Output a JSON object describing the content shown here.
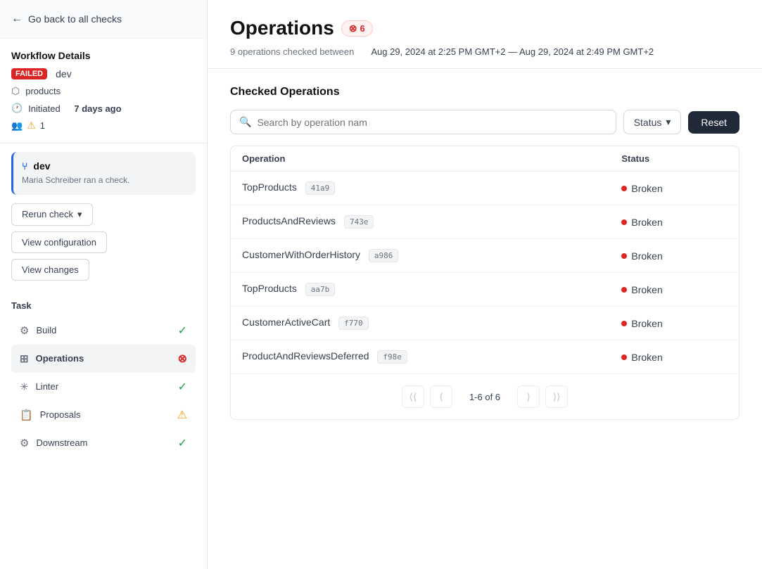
{
  "back": {
    "label": "Go back to all checks"
  },
  "sidebar": {
    "workflow_details_title": "Workflow Details",
    "failed_badge": "FAILED",
    "env": "dev",
    "products_label": "products",
    "initiated_label": "Initiated",
    "initiated_ago": "7 days ago",
    "alert_count": "1",
    "dev_card": {
      "name": "dev",
      "sub": "Maria Schreiber ran a check."
    },
    "buttons": {
      "rerun": "Rerun check",
      "view_config": "View configuration",
      "view_changes": "View changes"
    },
    "task_title": "Task",
    "tasks": [
      {
        "id": "build",
        "label": "Build",
        "status": "success"
      },
      {
        "id": "operations",
        "label": "Operations",
        "status": "fail",
        "active": true
      },
      {
        "id": "linter",
        "label": "Linter",
        "status": "success"
      },
      {
        "id": "proposals",
        "label": "Proposals",
        "status": "warn"
      },
      {
        "id": "downstream",
        "label": "Downstream",
        "status": "success"
      }
    ]
  },
  "main": {
    "title": "Operations",
    "error_badge": "6",
    "meta_ops": "9 operations checked between",
    "meta_range": "Aug 29, 2024 at 2:25 PM GMT+2 — Aug 29, 2024 at 2:49 PM GMT+2",
    "checked_ops_title": "Checked Operations",
    "search_placeholder": "Search by operation nam",
    "status_filter_label": "Status",
    "reset_label": "Reset",
    "table": {
      "col_operation": "Operation",
      "col_status": "Status",
      "rows": [
        {
          "name": "TopProducts",
          "hash": "41a9",
          "status": "Broken"
        },
        {
          "name": "ProductsAndReviews",
          "hash": "743e",
          "status": "Broken"
        },
        {
          "name": "CustomerWithOrderHistory",
          "hash": "a986",
          "status": "Broken"
        },
        {
          "name": "TopProducts",
          "hash": "aa7b",
          "status": "Broken"
        },
        {
          "name": "CustomerActiveCart",
          "hash": "f770",
          "status": "Broken"
        },
        {
          "name": "ProductAndReviewsDeferred",
          "hash": "f98e",
          "status": "Broken"
        }
      ]
    },
    "pagination": {
      "range": "1-6 of 6"
    }
  }
}
